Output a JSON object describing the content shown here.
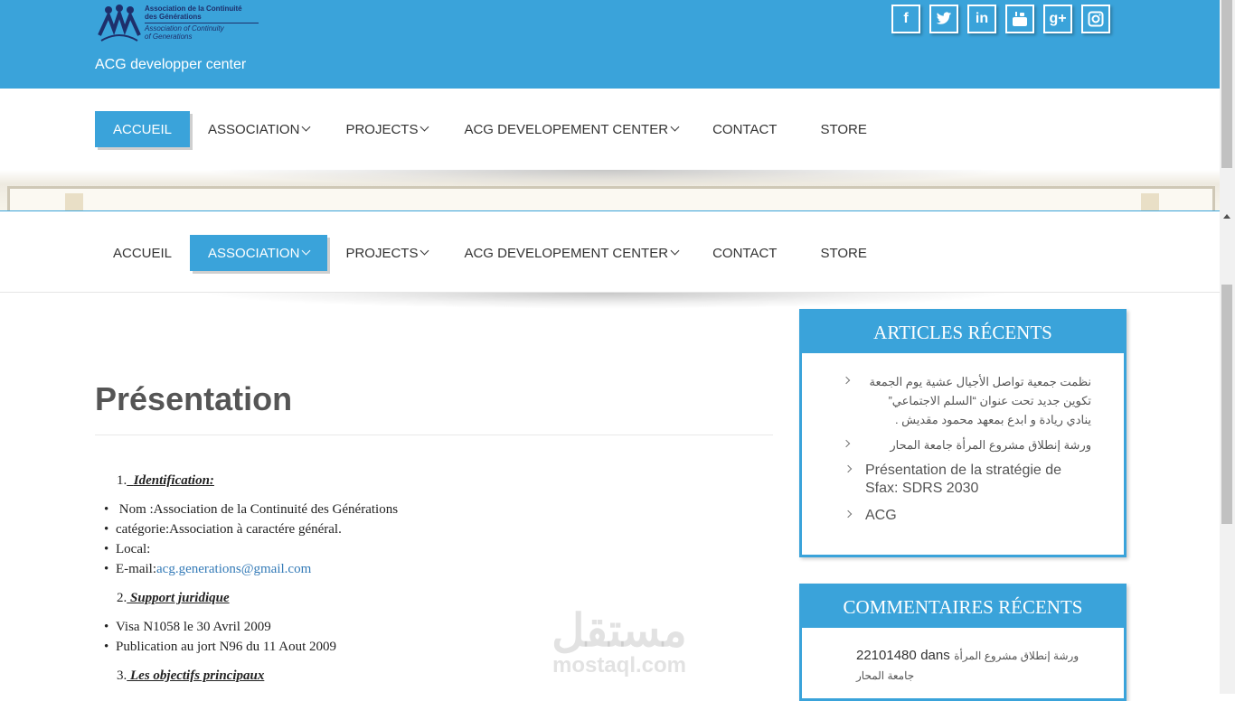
{
  "header": {
    "logo": {
      "line1": "Association  de la Continuité",
      "line2": "des Générations",
      "line3": "Association of Continuity",
      "line4": "of Generations"
    },
    "site_name": "ACG developper center",
    "social": [
      {
        "name": "facebook-icon",
        "glyph": "f"
      },
      {
        "name": "twitter-icon",
        "glyph": "t"
      },
      {
        "name": "linkedin-icon",
        "glyph": "in"
      },
      {
        "name": "youtube-icon",
        "glyph": "▶"
      },
      {
        "name": "googleplus-icon",
        "glyph": "g+"
      },
      {
        "name": "instagram-icon",
        "glyph": "◎"
      }
    ]
  },
  "nav": {
    "items": [
      "ACCUEIL",
      "ASSOCIATION",
      "PROJECTS",
      "ACG DEVELOPEMENT CENTER",
      "CONTACT",
      "STORE"
    ],
    "active_main": "ACCUEIL",
    "active_sticky": "ASSOCIATION"
  },
  "main": {
    "title": "Présentation",
    "sections": [
      {
        "num": "1.",
        "title": "Identification:"
      },
      {
        "num": "2.",
        "title": "Support juridique"
      },
      {
        "num": "3.",
        "title": "Les objectifs principaux"
      }
    ],
    "identification": [
      "Nom :Association de la Continuité des Générations",
      "catégorie:Association à caractére général.",
      "Local:"
    ],
    "email_label": "E-mail:",
    "email": "acg.generations@gmail.com",
    "support": [
      "Visa N1058 le 30 Avril 2009",
      "Publication au jort N96 du 11 Aout 2009"
    ]
  },
  "sidebar": {
    "recent_articles": {
      "title": "ARTICLES RÉCENTS",
      "items": [
        "نظمت جمعية تواصل الأجيال عشية يوم الجمعة تكوين جديد تحت عنوان “السلم الاجتماعي” ينادي ريادة و ابدع بمعهد محمود مقديش .",
        "ورشة إنطلاق مشروع المرأة جامعة المحار",
        "Présentation de la stratégie de Sfax: SDRS 2030",
        "ACG"
      ]
    },
    "recent_comments": {
      "title": "COMMENTAIRES RÉCENTS",
      "author": "22101480",
      "in_label": "dans",
      "post_line1": "ورشة إنطلاق مشروع المرأة",
      "post_line2": "جامعة المحار"
    }
  },
  "watermark": {
    "arabic": "مستقل",
    "latin": "mostaql.com"
  }
}
